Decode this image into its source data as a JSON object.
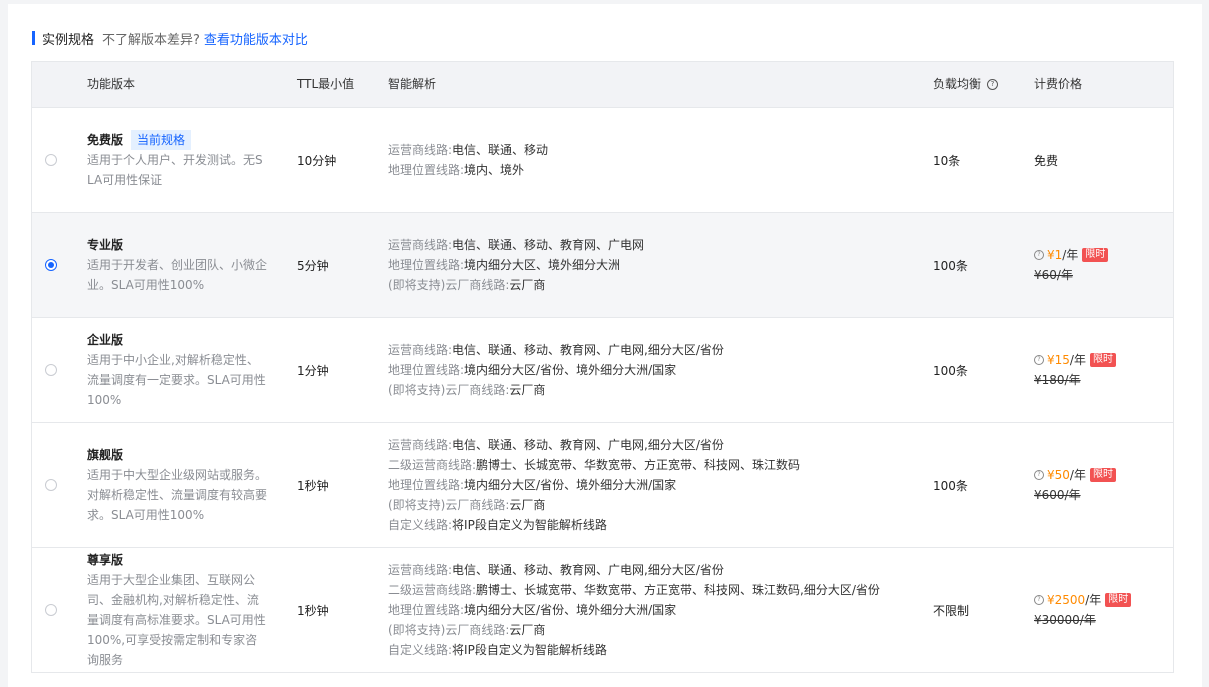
{
  "section": {
    "title": "实例规格",
    "hint": "不了解版本差异?",
    "link": "查看功能版本对比"
  },
  "table": {
    "headers": {
      "plan": "功能版本",
      "ttl": "TTL最小值",
      "smart": "智能解析",
      "lb": "负载均衡",
      "price": "计费价格"
    },
    "rows": [
      {
        "name": "免费版",
        "tag": "当前规格",
        "desc": "适用于个人用户、开发测试。无SLA可用性保证",
        "ttl": "10分钟",
        "features": [
          {
            "k": "运营商线路:",
            "v": "电信、联通、移动"
          },
          {
            "k": "地理位置线路:",
            "v": "境内、境外"
          }
        ],
        "lb": "10条",
        "price_text": "免费",
        "selected": false
      },
      {
        "name": "专业版",
        "desc": "适用于开发者、创业团队、小微企业。SLA可用性100%",
        "ttl": "5分钟",
        "features": [
          {
            "k": "运营商线路:",
            "v": "电信、联通、移动、教育网、广电网"
          },
          {
            "k": "地理位置线路:",
            "v": "境内细分大区、境外细分大洲"
          },
          {
            "k": "(即将支持)云厂商线路:",
            "v": "云厂商"
          }
        ],
        "lb": "100条",
        "price": {
          "amount": "¥1",
          "unit": "/年",
          "badge": "限时",
          "old": "¥60/年"
        },
        "selected": true
      },
      {
        "name": "企业版",
        "desc": "适用于中小企业,对解析稳定性、流量调度有一定要求。SLA可用性100%",
        "ttl": "1分钟",
        "features": [
          {
            "k": "运营商线路:",
            "v": "电信、联通、移动、教育网、广电网,细分大区/省份"
          },
          {
            "k": "地理位置线路:",
            "v": "境内细分大区/省份、境外细分大洲/国家"
          },
          {
            "k": "(即将支持)云厂商线路:",
            "v": "云厂商"
          }
        ],
        "lb": "100条",
        "price": {
          "amount": "¥15",
          "unit": "/年",
          "badge": "限时",
          "old": "¥180/年"
        },
        "selected": false
      },
      {
        "name": "旗舰版",
        "desc": "适用于中大型企业级网站或服务。对解析稳定性、流量调度有较高要求。SLA可用性100%",
        "ttl": "1秒钟",
        "features": [
          {
            "k": "运营商线路:",
            "v": "电信、联通、移动、教育网、广电网,细分大区/省份"
          },
          {
            "k": "二级运营商线路:",
            "v": "鹏博士、长城宽带、华数宽带、方正宽带、科技网、珠江数码"
          },
          {
            "k": "地理位置线路:",
            "v": "境内细分大区/省份、境外细分大洲/国家"
          },
          {
            "k": "(即将支持)云厂商线路:",
            "v": "云厂商"
          },
          {
            "k": "自定义线路:",
            "v": "将IP段自定义为智能解析线路"
          }
        ],
        "lb": "100条",
        "price": {
          "amount": "¥50",
          "unit": "/年",
          "badge": "限时",
          "old": "¥600/年"
        },
        "selected": false
      },
      {
        "name": "尊享版",
        "desc": "适用于大型企业集团、互联网公司、金融机构,对解析稳定性、流量调度有高标准要求。SLA可用性100%,可享受按需定制和专家咨询服务",
        "ttl": "1秒钟",
        "features": [
          {
            "k": "运营商线路:",
            "v": "电信、联通、移动、教育网、广电网,细分大区/省份"
          },
          {
            "k": "二级运营商线路:",
            "v": "鹏博士、长城宽带、华数宽带、方正宽带、科技网、珠江数码,细分大区/省份"
          },
          {
            "k": "地理位置线路:",
            "v": "境内细分大区/省份、境外细分大洲/国家"
          },
          {
            "k": "(即将支持)云厂商线路:",
            "v": "云厂商"
          },
          {
            "k": "自定义线路:",
            "v": "将IP段自定义为智能解析线路"
          }
        ],
        "lb": "不限制",
        "price": {
          "amount": "¥2500",
          "unit": "/年",
          "badge": "限时",
          "old": "¥30000/年"
        },
        "selected": false
      }
    ]
  }
}
